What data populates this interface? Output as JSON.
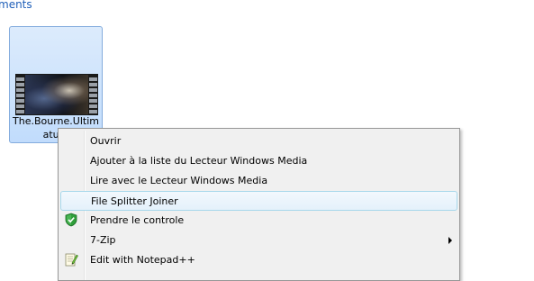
{
  "header": {
    "breadcrumb_fragment": "ments"
  },
  "file": {
    "name": "The.Bourne.Ultim\natum"
  },
  "context_menu": {
    "items": [
      {
        "label": "Ouvrir"
      },
      {
        "label": "Ajouter à la liste du Lecteur Windows Media"
      },
      {
        "label": "Lire avec le Lecteur Windows Media"
      },
      {
        "label": "File Splitter Joiner"
      },
      {
        "label": "Prendre le controle",
        "icon": "shield-check-icon"
      },
      {
        "label": "7-Zip",
        "has_submenu": true
      },
      {
        "label": "Edit with Notepad++",
        "icon": "notepad-icon"
      }
    ],
    "highlighted_index": 3
  },
  "colors": {
    "selection_fill": "#c1dcfc",
    "selection_border": "#84acdd",
    "menu_background": "#f0f0f0",
    "hover_border": "#a8d8eb",
    "link_blue": "#1e5eb8"
  }
}
